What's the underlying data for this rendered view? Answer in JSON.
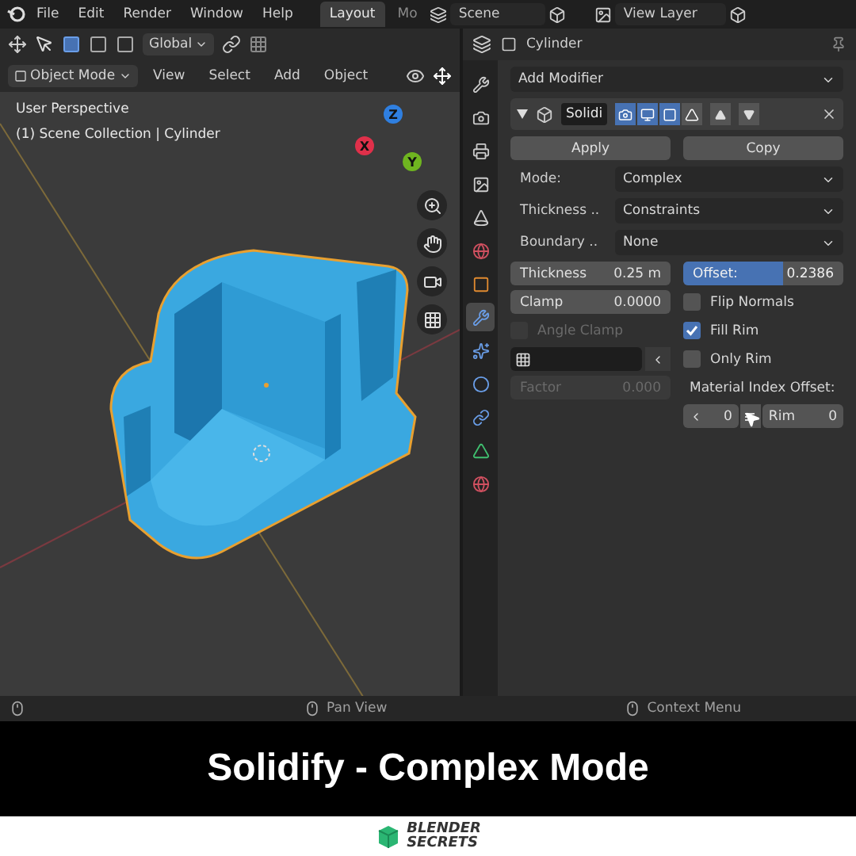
{
  "menubar": {
    "menus": [
      "File",
      "Edit",
      "Render",
      "Window",
      "Help"
    ],
    "workspaces": [
      {
        "label": "Layout",
        "selected": true
      },
      {
        "label": "Mo",
        "selected": false
      }
    ],
    "scene": "Scene",
    "view_layer": "View Layer"
  },
  "viewport": {
    "orientation": "Global",
    "mode": "Object Mode",
    "menus": [
      "View",
      "Select",
      "Add",
      "Object"
    ],
    "perspective": "User Perspective",
    "collection": "(1) Scene Collection | Cylinder",
    "gizmo": [
      {
        "label": "Z",
        "color": "#2f7fe0"
      },
      {
        "label": "Y",
        "color": "#6fb520"
      },
      {
        "label": "X",
        "color": "#e0304a"
      }
    ]
  },
  "property_tabs": [
    {
      "kind": "tool",
      "selected": false
    },
    {
      "kind": "render",
      "selected": false
    },
    {
      "kind": "output",
      "selected": false
    },
    {
      "kind": "view_layer",
      "selected": false
    },
    {
      "kind": "scene",
      "selected": false
    },
    {
      "kind": "world",
      "selected": false
    },
    {
      "kind": "object",
      "selected": false
    },
    {
      "kind": "modifier",
      "selected": true
    },
    {
      "kind": "particles",
      "selected": false
    },
    {
      "kind": "physics",
      "selected": false
    },
    {
      "kind": "constraints",
      "selected": false
    },
    {
      "kind": "data",
      "selected": false
    },
    {
      "kind": "material",
      "selected": false
    }
  ],
  "properties": {
    "object": "Cylinder",
    "add_modifier": "Add Modifier",
    "modifier": {
      "name": "Solidi",
      "expanded": true,
      "toggles": [
        {
          "kind": "render",
          "on": true
        },
        {
          "kind": "viewport",
          "on": true
        },
        {
          "kind": "editmode",
          "on": true
        },
        {
          "kind": "cage",
          "on": false
        }
      ]
    },
    "apply": "Apply",
    "copy": "Copy",
    "dropdowns": [
      {
        "label": "Mode:",
        "value": "Complex"
      },
      {
        "label": "Thickness ..",
        "value": "Constraints"
      },
      {
        "label": "Boundary ..",
        "value": "None"
      }
    ],
    "left_fields": [
      {
        "label": "Thickness",
        "value": "0.25 m"
      },
      {
        "label": "Clamp",
        "value": "0.0000"
      }
    ],
    "offset": {
      "label": "Offset:",
      "value": "0.2386",
      "level": 0.62
    },
    "angle_clamp": {
      "label": "Angle Clamp",
      "checked": false,
      "disabled": true
    },
    "checkboxes": [
      {
        "label": "Flip Normals",
        "checked": false
      },
      {
        "label": "Fill Rim",
        "checked": true
      },
      {
        "label": "Only Rim",
        "checked": false
      }
    ],
    "factor": {
      "label": "Factor",
      "value": "0.000",
      "disabled": true
    },
    "material_offset": {
      "label": "Material Index Offset:",
      "value": "0",
      "rim_label": "Rim",
      "rim_value": "0"
    }
  },
  "status_bar": [
    "Pan View",
    "Context Menu"
  ],
  "caption": "Solidify - Complex Mode",
  "brand": [
    "BLENDER",
    "SECRETS"
  ]
}
